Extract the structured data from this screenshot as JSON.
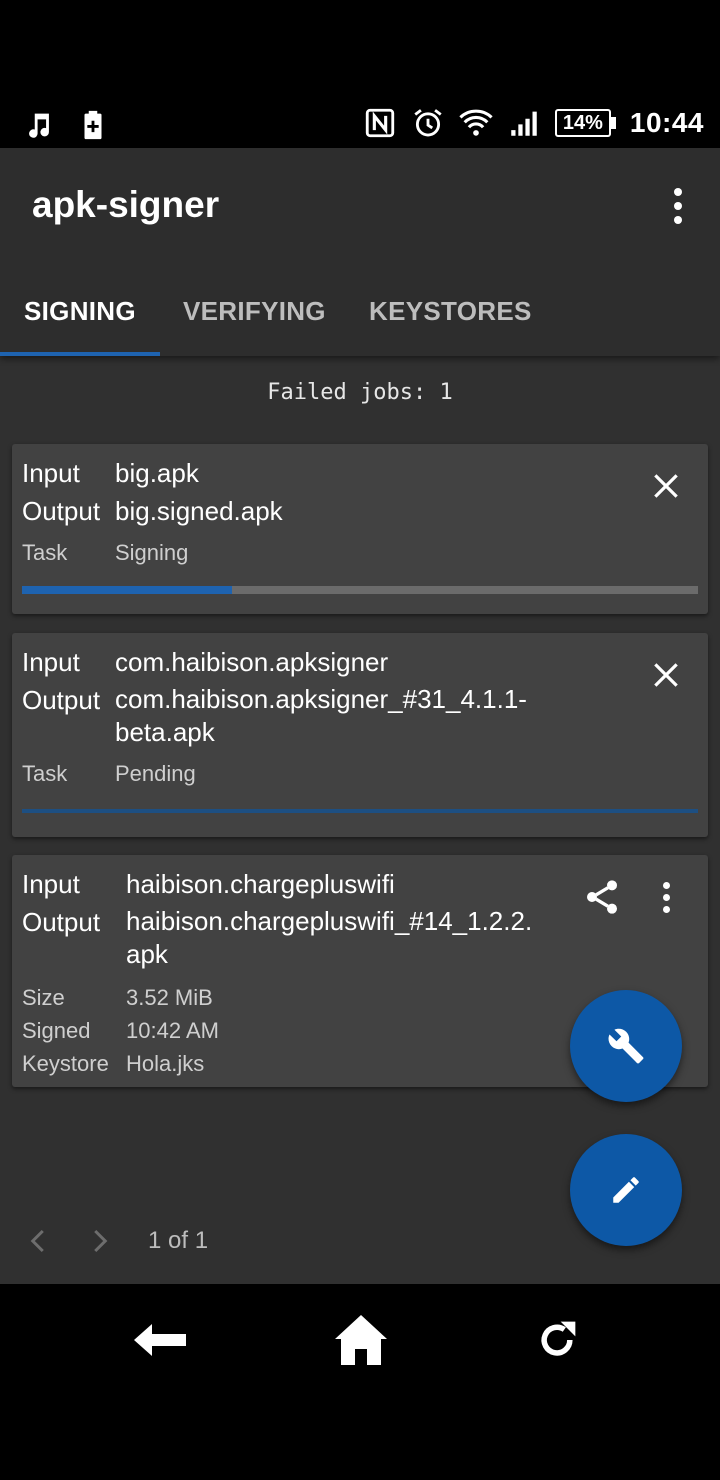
{
  "status_bar": {
    "time": "10:44",
    "battery": "14%",
    "icons": [
      "music-note-icon",
      "battery-saver-icon",
      "nfc-icon",
      "alarm-icon",
      "wifi-icon",
      "cell-signal-icon"
    ]
  },
  "app_bar": {
    "title": "apk-signer",
    "overflow_icon": "more-vert-icon"
  },
  "tabs": [
    {
      "label": "SIGNING",
      "active": true
    },
    {
      "label": "VERIFYING",
      "active": false
    },
    {
      "label": "KEYSTORES",
      "active": false
    }
  ],
  "failed_jobs": "Failed jobs: 1",
  "jobs": [
    {
      "input_label": "Input",
      "input": "big.apk",
      "output_label": "Output",
      "output": "big.signed.apk",
      "task_label": "Task",
      "task": "Signing",
      "progress": 0.31
    },
    {
      "input_label": "Input",
      "input": "com.haibison.apksigner",
      "output_label": "Output",
      "output_line1": "com.haibison.apksigner_#31_4.1.1-",
      "output_line2": "beta.apk",
      "task_label": "Task",
      "task": "Pending"
    }
  ],
  "completed": {
    "input_label": "Input",
    "input": "haibison.chargepluswifi",
    "output_label": "Output",
    "output_line1": "haibison.chargepluswifi_#14_1.2.2.",
    "output_line2": "apk",
    "size_label": "Size",
    "size": "3.52 MiB",
    "signed_label": "Signed",
    "signed": "10:42 AM",
    "keystore_label": "Keystore",
    "keystore": "Hola.jks"
  },
  "pager": {
    "label": "1 of 1"
  },
  "colors": {
    "accent": "#1e63b0",
    "fab": "#0d58a6",
    "card": "#424242",
    "background": "#303030"
  }
}
